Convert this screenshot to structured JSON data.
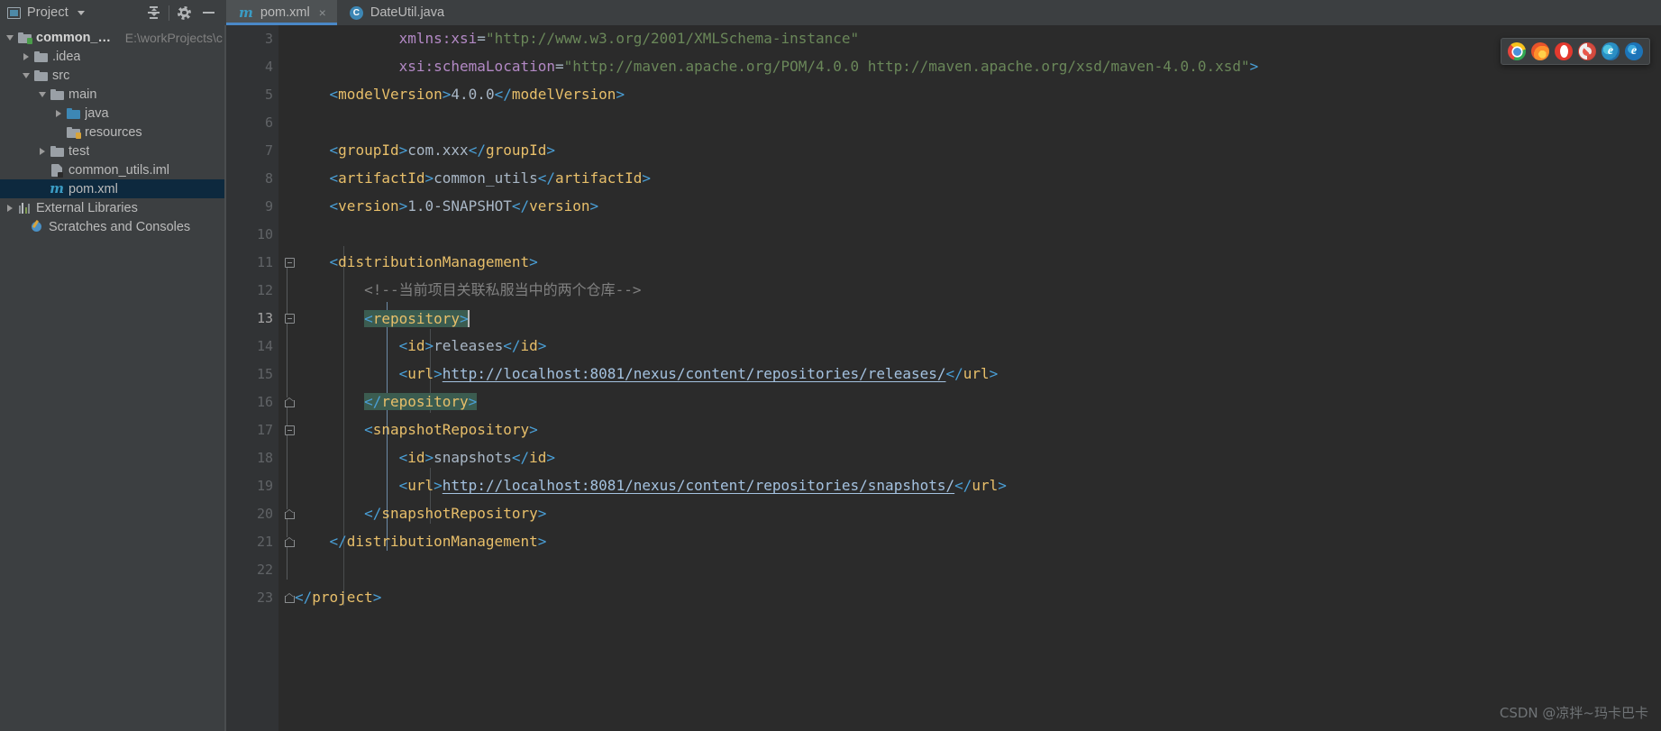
{
  "toolwindow": {
    "title": "Project",
    "caret_icon": "chevron-down-icon",
    "actions": [
      {
        "name": "collapse-all-icon",
        "tooltip": "Collapse All"
      },
      {
        "name": "gear-icon",
        "tooltip": "Settings"
      },
      {
        "name": "minimize-icon",
        "tooltip": "Hide"
      }
    ]
  },
  "tabs": [
    {
      "label": "pom.xml",
      "icon": "maven-file-icon",
      "active": true,
      "close": "×"
    },
    {
      "label": "DateUtil.java",
      "icon": "java-class-icon",
      "active": false,
      "close": ""
    }
  ],
  "tree": [
    {
      "label": "common_utils",
      "path": "E:\\workProjects\\co",
      "depth": 0,
      "arrow": "down",
      "icon": "module-folder-icon",
      "bold": true,
      "selected": false
    },
    {
      "label": ".idea",
      "path": "",
      "depth": 1,
      "arrow": "right",
      "icon": "folder-icon",
      "bold": false,
      "selected": false
    },
    {
      "label": "src",
      "path": "",
      "depth": 1,
      "arrow": "down",
      "icon": "folder-icon",
      "bold": false,
      "selected": false
    },
    {
      "label": "main",
      "path": "",
      "depth": 2,
      "arrow": "down",
      "icon": "folder-icon",
      "bold": false,
      "selected": false
    },
    {
      "label": "java",
      "path": "",
      "depth": 3,
      "arrow": "right",
      "icon": "sources-folder-icon",
      "bold": false,
      "selected": false
    },
    {
      "label": "resources",
      "path": "",
      "depth": 3,
      "arrow": "none",
      "icon": "resources-folder-icon",
      "bold": false,
      "selected": false
    },
    {
      "label": "test",
      "path": "",
      "depth": 2,
      "arrow": "right",
      "icon": "folder-icon",
      "bold": false,
      "selected": false
    },
    {
      "label": "common_utils.iml",
      "path": "",
      "depth": 2,
      "arrow": "none",
      "icon": "iml-file-icon",
      "bold": false,
      "selected": false
    },
    {
      "label": "pom.xml",
      "path": "",
      "depth": 2,
      "arrow": "none",
      "icon": "maven-file-icon",
      "bold": false,
      "selected": true
    },
    {
      "label": "External Libraries",
      "path": "",
      "depth": 0,
      "arrow": "right",
      "icon": "libraries-icon",
      "bold": false,
      "selected": false
    },
    {
      "label": "Scratches and Consoles",
      "path": "",
      "depth": 0,
      "arrow": "none",
      "icon": "scratches-icon",
      "bold": false,
      "selected": false
    }
  ],
  "editor": {
    "current_line": 13,
    "first_visible_line": 3,
    "lines": [
      {
        "n": 3,
        "fold": "none",
        "text": "            xmlns:xsi=\"http://www.w3.org/2001/XMLSchema-instance\""
      },
      {
        "n": 4,
        "fold": "none",
        "text": "            xsi:schemaLocation=\"http://maven.apache.org/POM/4.0.0 http://maven.apache.org/xsd/maven-4.0.0.xsd\">"
      },
      {
        "n": 5,
        "fold": "none",
        "text": "    <modelVersion>4.0.0</modelVersion>"
      },
      {
        "n": 6,
        "fold": "none",
        "text": ""
      },
      {
        "n": 7,
        "fold": "none",
        "text": "    <groupId>com.xxx</groupId>"
      },
      {
        "n": 8,
        "fold": "none",
        "text": "    <artifactId>common_utils</artifactId>"
      },
      {
        "n": 9,
        "fold": "none",
        "text": "    <version>1.0-SNAPSHOT</version>"
      },
      {
        "n": 10,
        "fold": "none",
        "text": ""
      },
      {
        "n": 11,
        "fold": "open",
        "text": "    <distributionManagement>"
      },
      {
        "n": 12,
        "fold": "none",
        "text": "        <!--当前项目关联私服当中的两个仓库-->"
      },
      {
        "n": 13,
        "fold": "open",
        "text": "        <repository>"
      },
      {
        "n": 14,
        "fold": "none",
        "text": "            <id>releases</id>"
      },
      {
        "n": 15,
        "fold": "none",
        "text": "            <url>http://localhost:8081/nexus/content/repositories/releases/</url>"
      },
      {
        "n": 16,
        "fold": "end",
        "text": "        </repository>"
      },
      {
        "n": 17,
        "fold": "open",
        "text": "        <snapshotRepository>"
      },
      {
        "n": 18,
        "fold": "none",
        "text": "            <id>snapshots</id>"
      },
      {
        "n": 19,
        "fold": "none",
        "text": "            <url>http://localhost:8081/nexus/content/repositories/snapshots/</url>"
      },
      {
        "n": 20,
        "fold": "end",
        "text": "        </snapshotRepository>"
      },
      {
        "n": 21,
        "fold": "end",
        "text": "    </distributionManagement>"
      },
      {
        "n": 22,
        "fold": "none",
        "text": ""
      },
      {
        "n": 23,
        "fold": "end",
        "text": "</project>"
      }
    ],
    "urls": [
      "http://localhost:8081/nexus/content/repositories/releases/",
      "http://localhost:8081/nexus/content/repositories/snapshots/"
    ],
    "highlighted_tokens": [
      "<repository>",
      "</repository>"
    ]
  },
  "browser_popup": {
    "icons": [
      "chrome-icon",
      "firefox-icon",
      "opera-icon",
      "safari-icon",
      "edge-legacy-icon",
      "edge-icon"
    ],
    "edge_legacy_glyph": "e",
    "edge_glyph": "e"
  },
  "watermark": "CSDN @凉拌~玛卡巴卡",
  "colors": {
    "background": "#2b2b2b",
    "panel": "#3c3f41",
    "gutter": "#313335",
    "selection": "#0d293e",
    "accent": "#4a88c7",
    "tag": "#e8bf6a",
    "bracket": "#4a9fd6",
    "attribute": "#b389c5",
    "string": "#6a8759",
    "comment": "#808080",
    "text": "#a9b7c6",
    "link": "#a4c2e0",
    "highlight": "#3b5c50"
  }
}
